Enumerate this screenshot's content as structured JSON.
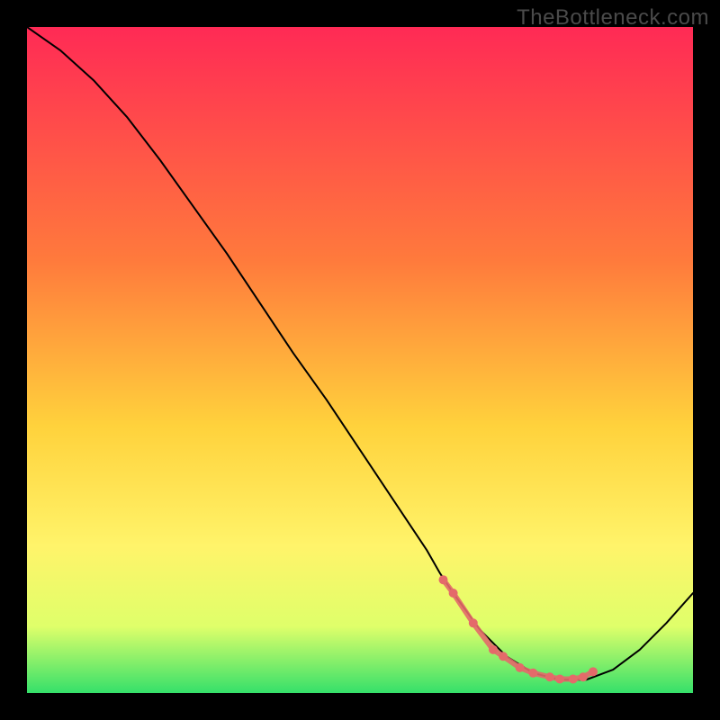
{
  "watermark": "TheBottleneck.com",
  "chart_data": {
    "type": "line",
    "title": "",
    "xlabel": "",
    "ylabel": "",
    "xlim": [
      0,
      100
    ],
    "ylim": [
      0,
      100
    ],
    "series": [
      {
        "name": "curve",
        "x": [
          0,
          5,
          10,
          15,
          20,
          25,
          30,
          35,
          40,
          45,
          50,
          55,
          60,
          62,
          64,
          68,
          72,
          76,
          80,
          82,
          84,
          88,
          92,
          96,
          100
        ],
        "values": [
          100,
          96.5,
          92,
          86.5,
          80,
          73,
          66,
          58.5,
          51,
          44,
          36.5,
          29,
          21.5,
          18,
          15,
          9.5,
          5.5,
          3,
          2,
          2,
          2,
          3.5,
          6.5,
          10.5,
          15
        ],
        "stroke": "#000000",
        "width": 2
      }
    ],
    "markers": {
      "name": "highlight-band",
      "color": "#e46a6a",
      "x": [
        62.5,
        64,
        67,
        70,
        71.5,
        74,
        76,
        78.5,
        80,
        82,
        83.5,
        85
      ],
      "values": [
        17,
        15,
        10.5,
        6.5,
        5.5,
        3.8,
        3,
        2.4,
        2.1,
        2.1,
        2.4,
        3.2
      ]
    },
    "gradient_stops": [
      {
        "offset": 0,
        "color": "#ff2a55"
      },
      {
        "offset": 35,
        "color": "#ff7a3c"
      },
      {
        "offset": 60,
        "color": "#ffd23c"
      },
      {
        "offset": 78,
        "color": "#fff46a"
      },
      {
        "offset": 90,
        "color": "#dfff6a"
      },
      {
        "offset": 100,
        "color": "#35e06a"
      }
    ]
  }
}
